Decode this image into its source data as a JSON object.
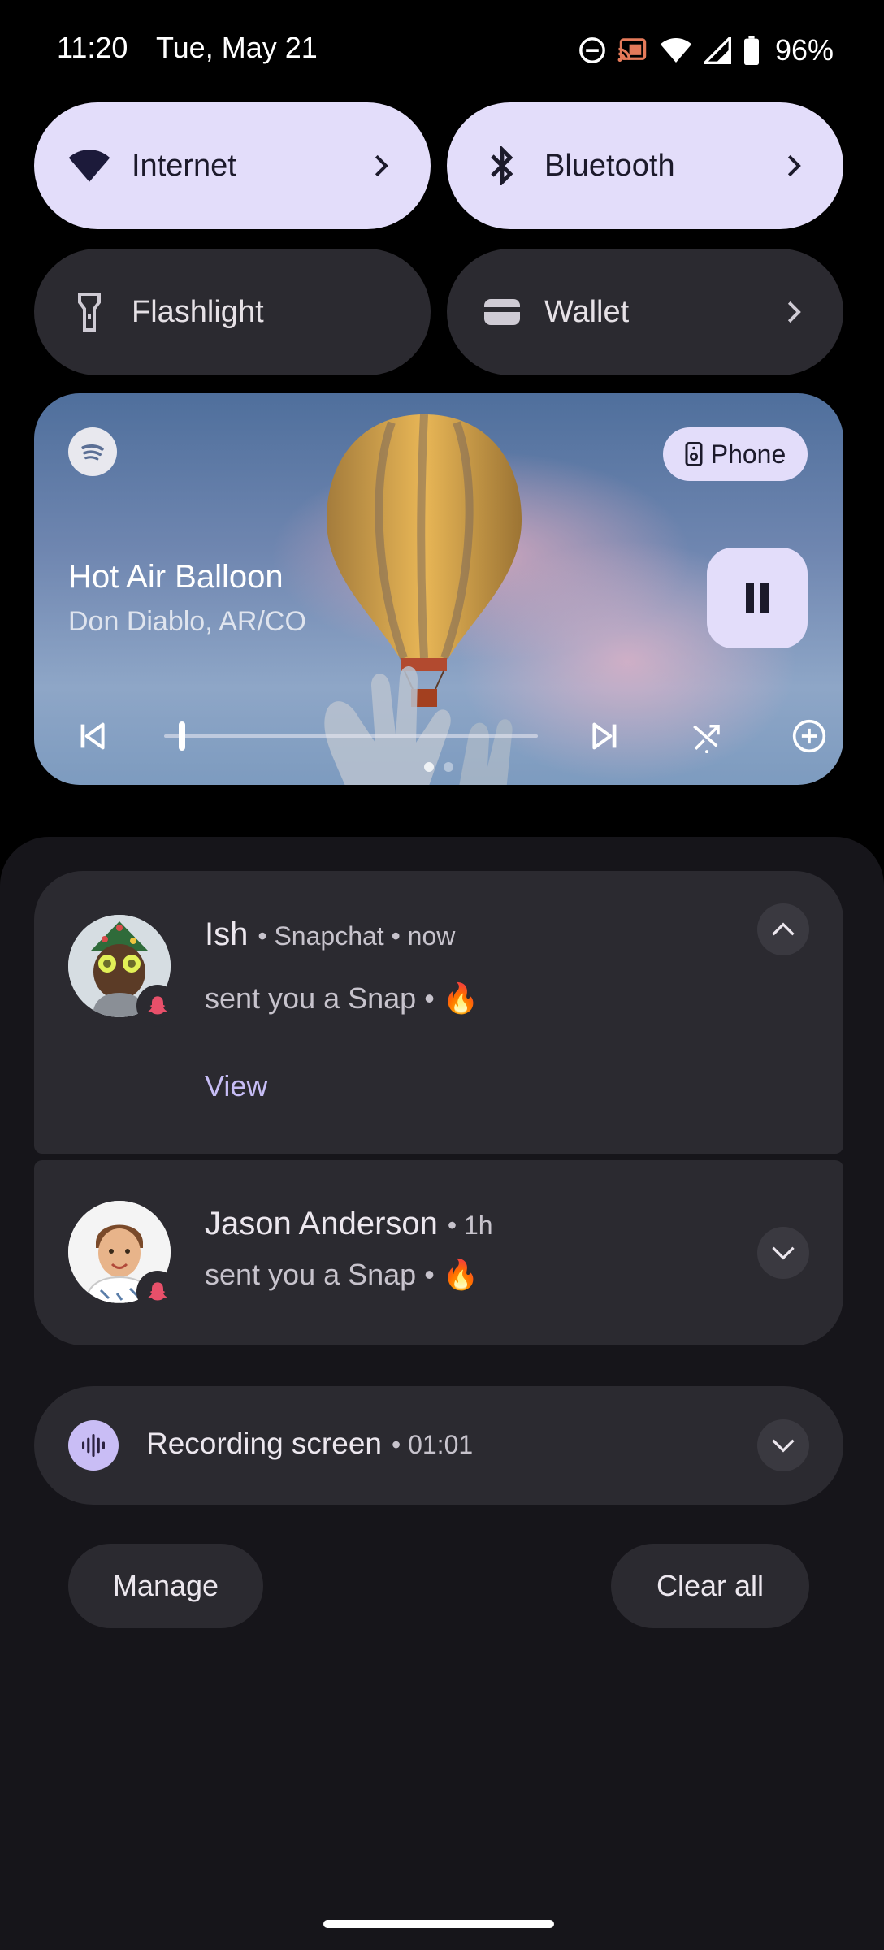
{
  "status_bar": {
    "time": "11:20",
    "date": "Tue, May 21",
    "battery": "96%",
    "icons": [
      "do-not-disturb-icon",
      "cast-icon",
      "wifi-icon",
      "signal-icon",
      "battery-icon"
    ]
  },
  "quick_settings": {
    "tiles": [
      {
        "label": "Internet",
        "icon": "wifi-icon",
        "active": true
      },
      {
        "label": "Bluetooth",
        "icon": "bluetooth-icon",
        "active": true
      },
      {
        "label": "Flashlight",
        "icon": "flashlight-icon",
        "active": false
      },
      {
        "label": "Wallet",
        "icon": "wallet-icon",
        "active": false
      }
    ]
  },
  "media": {
    "app_icon": "spotify-icon",
    "output": "Phone",
    "title": "Hot Air Balloon",
    "artist": "Don Diablo, AR/CO",
    "progress": 0.04,
    "controls": [
      "previous-icon",
      "next-icon",
      "shuffle-icon",
      "add-icon"
    ]
  },
  "notifications": [
    {
      "name": "Ish",
      "meta": "• Snapchat • now",
      "message": "sent you a Snap • 🔥",
      "action": "View",
      "expanded": true
    },
    {
      "name": "Jason Anderson",
      "meta": "• 1h",
      "message": "sent you a Snap • 🔥",
      "expanded": false
    }
  ],
  "recording": {
    "label": "Recording screen",
    "meta": "• 01:01"
  },
  "footer": {
    "manage": "Manage",
    "clear_all": "Clear all"
  },
  "colors": {
    "tile_active": "#e3ddfa",
    "tile_inactive": "#2b2a30",
    "card": "#2b2a30",
    "accent_link": "#c7bdf5"
  }
}
